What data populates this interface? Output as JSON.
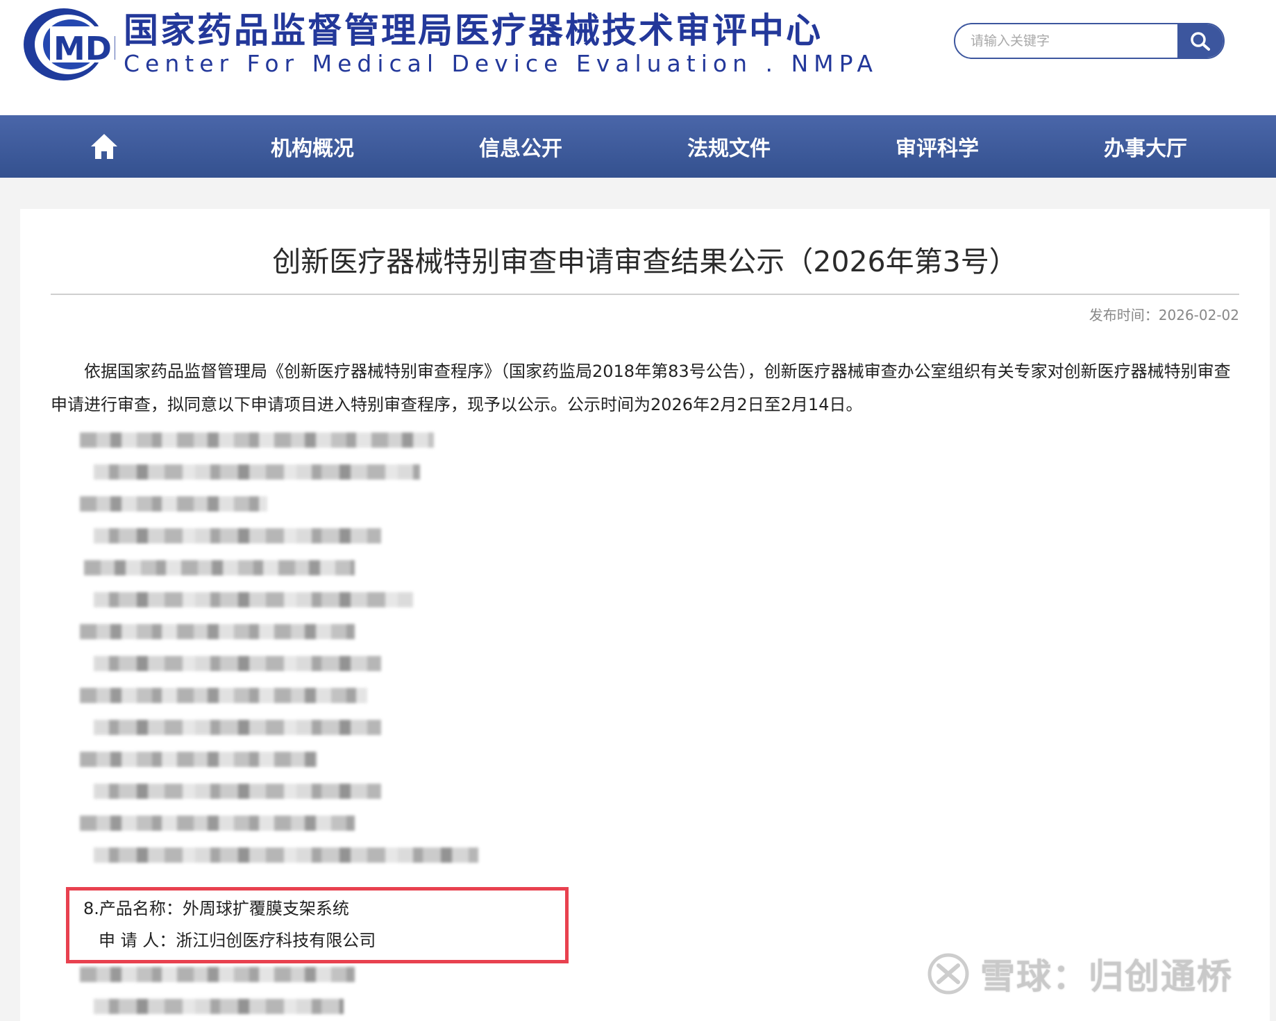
{
  "header": {
    "logo_text": "MDE",
    "title_cn": "国家药品监督管理局医疗器械技术审评中心",
    "title_en": "Center  For  Medical  Device  Evaluation . NMPA",
    "search": {
      "placeholder": "请输入关键字",
      "value": "",
      "button_icon": "search-icon"
    }
  },
  "nav": {
    "home_icon": "home-icon",
    "items": [
      {
        "label": "机构概况"
      },
      {
        "label": "信息公开"
      },
      {
        "label": "法规文件"
      },
      {
        "label": "审评科学"
      },
      {
        "label": "办事大厅"
      }
    ]
  },
  "article": {
    "title": "创新医疗器械特别审查申请审查结果公示（2026年第3号）",
    "publish_label": "发布时间：",
    "publish_date": "2026-02-02",
    "intro": "依据国家药品监督管理局《创新医疗器械特别审查程序》（国家药监局2018年第83号公告），创新医疗器械审查办公室组织有关专家对创新医疗器械特别审查申请进行审查，拟同意以下申请项目进入特别审查程序，现予以公示。公示时间为2026年2月2日至2月14日。",
    "highlighted_entry": {
      "product": "8.产品名称：外周球扩覆膜支架系统",
      "applicant": "申 请 人：浙江归创医疗科技有限公司"
    }
  },
  "watermark": {
    "text": "雪球：归创通桥",
    "icon": "xueqiu-logo-icon"
  },
  "colors": {
    "brand_blue": "#23389a",
    "nav_blue": "#3c569e",
    "highlight_red": "#e8414f"
  }
}
